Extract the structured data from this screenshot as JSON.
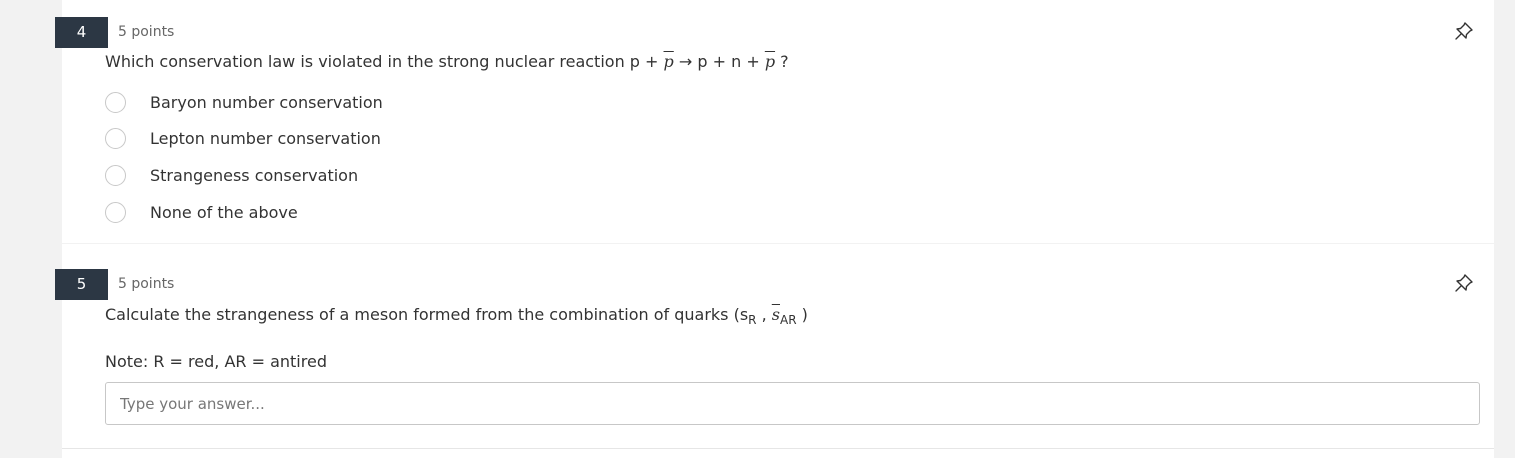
{
  "question4": {
    "number": "4",
    "points": "5 points",
    "text_prefix": "Which conservation law is violated in the strong nuclear reaction p + ",
    "text_math_1": "p",
    "text_middle": " → p + n + ",
    "text_math_2": "p",
    "text_suffix": " ?",
    "options": [
      {
        "label": "Baryon number conservation"
      },
      {
        "label": "Lepton number conservation"
      },
      {
        "label": "Strangeness conservation"
      },
      {
        "label": "None of the above"
      }
    ]
  },
  "question5": {
    "number": "5",
    "points": "5 points",
    "text_prefix": "Calculate the strangeness of a meson formed from the combination of quarks (s",
    "sub_1": "R",
    "comma": " , ",
    "text_math_1": "s",
    "sub_2": "AR",
    "text_suffix": " )",
    "note": "Note: R = red, AR = antired",
    "answer_placeholder": "Type your answer..."
  },
  "icons": {
    "pin": "pin-icon",
    "radio": "radio-button-icon"
  },
  "colors": {
    "number_badge": "#2c3744",
    "page_background": "#f2f2f2",
    "card_background": "#ffffff"
  }
}
